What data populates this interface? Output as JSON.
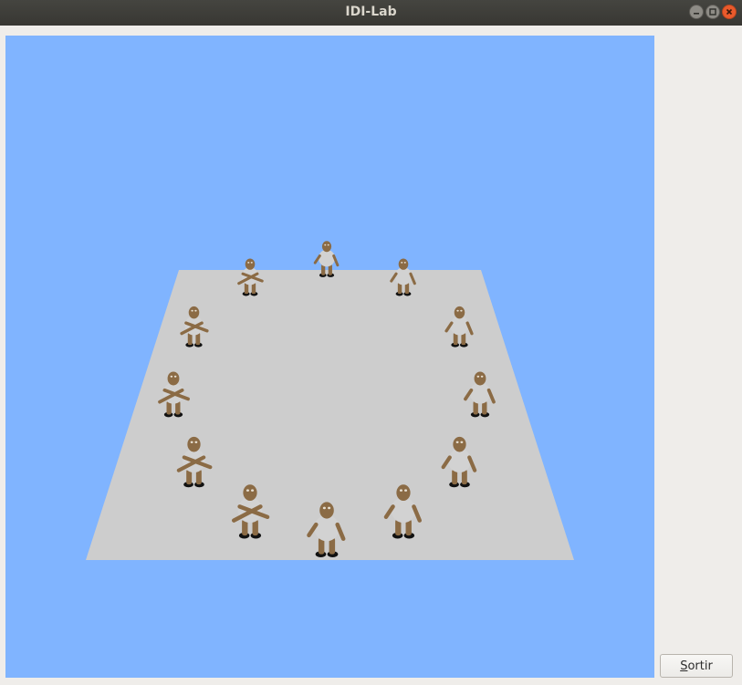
{
  "window": {
    "title": "IDI-Lab",
    "controls": [
      "minimize-icon",
      "maximize-icon",
      "close-icon"
    ]
  },
  "scene": {
    "background_color": "#80b4ff",
    "floor_color": "#cdcdcd",
    "figure_count": 12,
    "figure_colors": {
      "skin": "#8b6b45",
      "shirt": "#d2d2d2",
      "shoes": "#111111"
    }
  },
  "buttons": {
    "exit_label": "Sortir",
    "exit_mnemonic": "S",
    "exit_rest": "ortir"
  }
}
